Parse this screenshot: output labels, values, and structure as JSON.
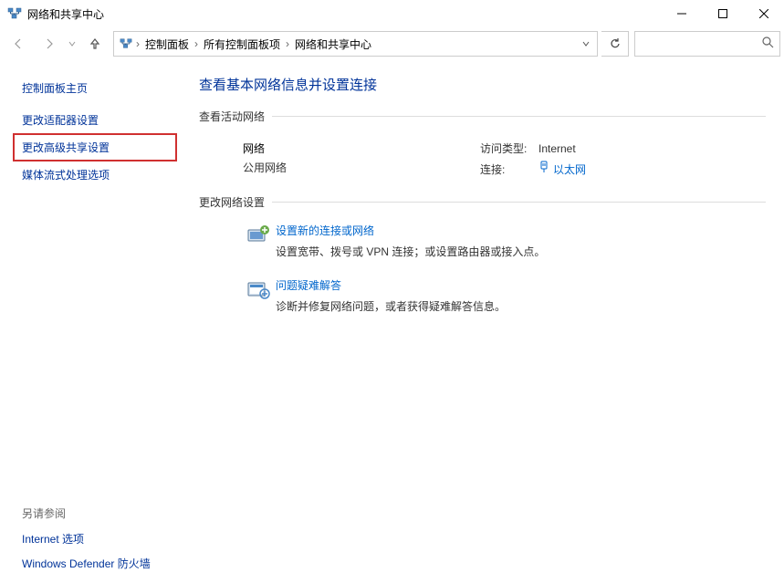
{
  "window": {
    "title": "网络和共享中心"
  },
  "breadcrumbs": {
    "item1": "控制面板",
    "item2": "所有控制面板项",
    "item3": "网络和共享中心"
  },
  "sidebar": {
    "home": "控制面板主页",
    "items": [
      {
        "label": "更改适配器设置"
      },
      {
        "label": "更改高级共享设置"
      },
      {
        "label": "媒体流式处理选项"
      }
    ],
    "see_also_h": "另请参阅",
    "see_also": [
      {
        "label": "Internet 选项"
      },
      {
        "label": "Windows Defender 防火墙"
      }
    ]
  },
  "main": {
    "heading": "查看基本网络信息并设置连接",
    "active_net_h": "查看活动网络",
    "network": {
      "name": "网络",
      "type": "公用网络",
      "access_label": "访问类型:",
      "access_value": "Internet",
      "conn_label": "连接:",
      "conn_value": "以太网"
    },
    "change_h": "更改网络设置",
    "settings": [
      {
        "title": "设置新的连接或网络",
        "desc": "设置宽带、拨号或 VPN 连接；或设置路由器或接入点。"
      },
      {
        "title": "问题疑难解答",
        "desc": "诊断并修复网络问题，或者获得疑难解答信息。"
      }
    ]
  }
}
